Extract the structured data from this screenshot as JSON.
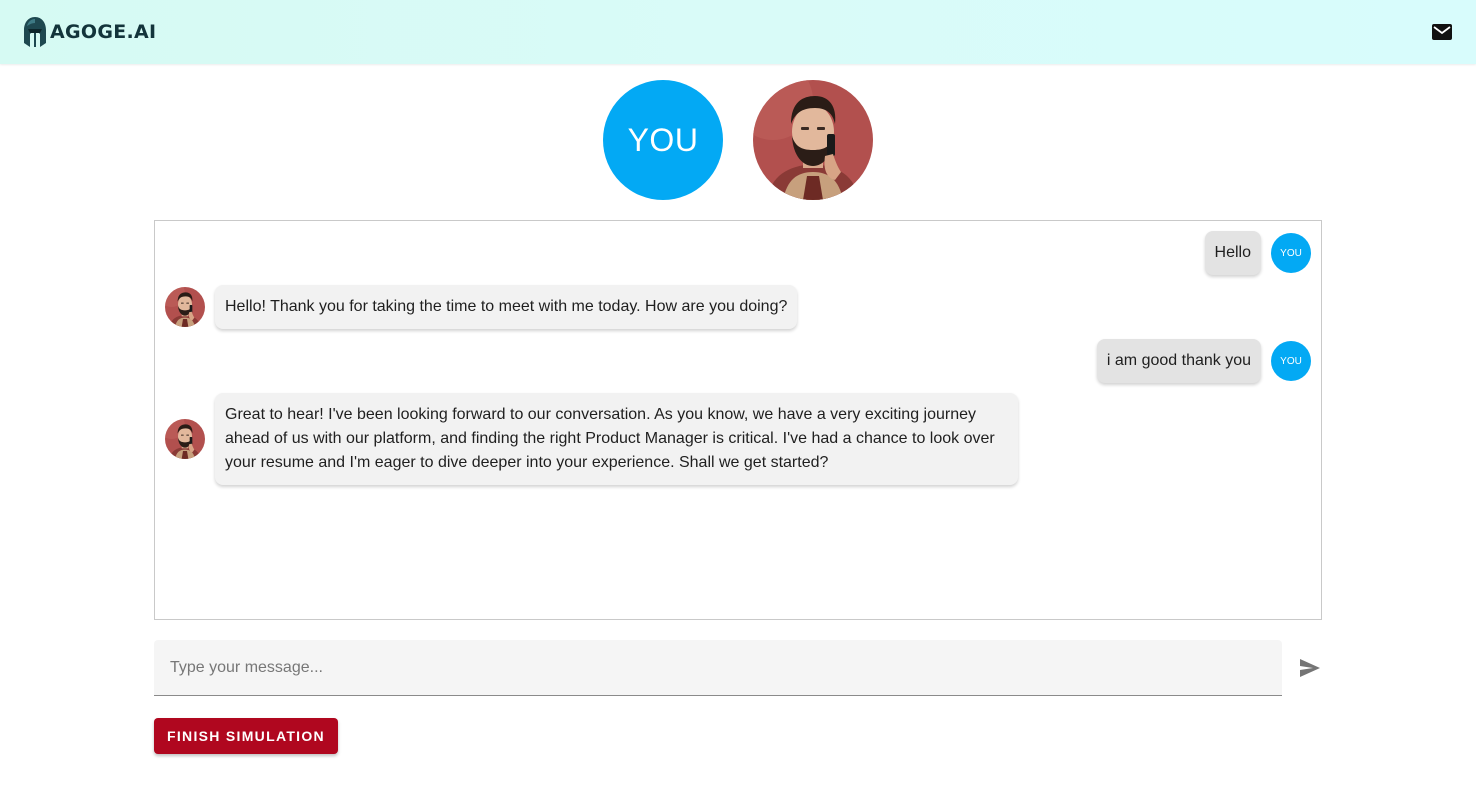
{
  "header": {
    "brand": "AGOGE.AI",
    "logo_icon": "helmet-icon",
    "mail_icon": "mail-icon"
  },
  "participants": {
    "user_label": "YOU",
    "bot_avatar": "man-on-phone-portrait"
  },
  "chat": {
    "messages": [
      {
        "sender": "user",
        "avatar_label": "YOU",
        "text": "Hello"
      },
      {
        "sender": "bot",
        "text": "Hello! Thank you for taking the time to meet with me today. How are you doing?"
      },
      {
        "sender": "user",
        "avatar_label": "YOU",
        "text": "i am good thank you"
      },
      {
        "sender": "bot",
        "text": "Great to hear! I've been looking forward to our conversation. As you know, we have a very exciting journey ahead of us with our platform, and finding the right Product Manager is critical. I've had a chance to look over your resume and I'm eager to dive deeper into your experience. Shall we get started?"
      }
    ]
  },
  "composer": {
    "placeholder": "Type your message...",
    "value": "",
    "send_icon": "send-icon"
  },
  "actions": {
    "finish_label": "FINISH SIMULATION"
  },
  "colors": {
    "accent": "#03a9f4",
    "finish_button": "#b0071f",
    "header_bg": "#d8fbf8"
  }
}
